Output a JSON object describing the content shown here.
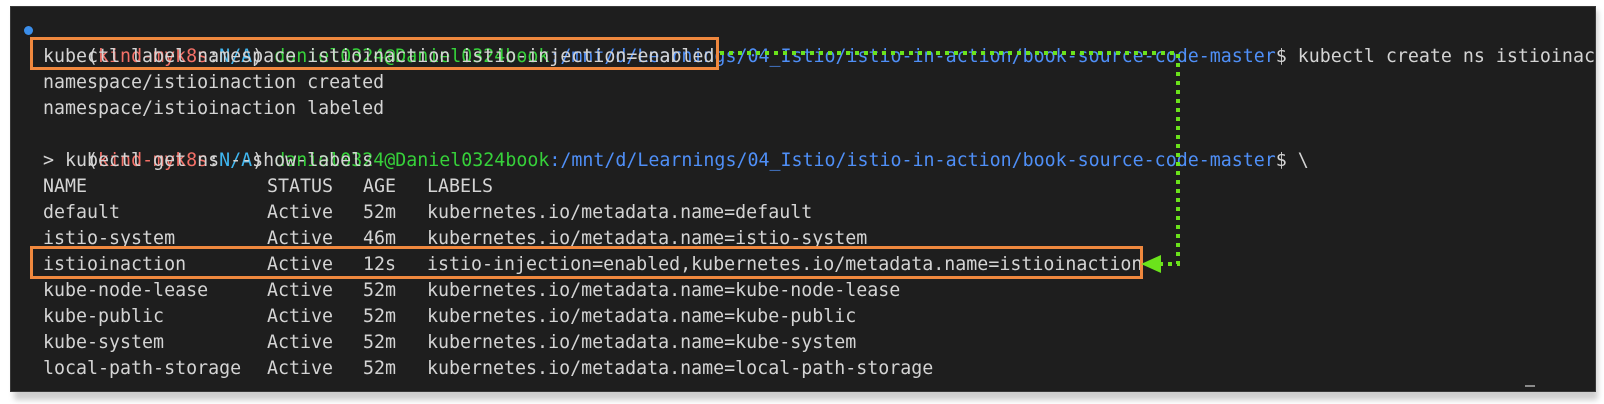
{
  "prompt1": {
    "open_paren": "(",
    "context": "kind-myk8s",
    "colon": ":",
    "namespace": "N/A",
    "close_paren": ")",
    "user": "daniel0324@Daniel0324book",
    "path": ":/mnt/d/Learnings/04_Istio/istio-in-action/book-source-code-master",
    "dollar": "$",
    "command": " kubectl create ns istioinaction"
  },
  "cmd_label": "kubectl label namespace istioinaction istio-injection=enabled",
  "output": {
    "created": "namespace/istioinaction created",
    "labeled": "namespace/istioinaction labeled"
  },
  "prompt2": {
    "open_paren": "(",
    "context": "kind-myk8s",
    "colon": ":",
    "namespace": "N/A",
    "close_paren": ")",
    "user": "daniel0324@Daniel0324book",
    "path": ":/mnt/d/Learnings/04_Istio/istio-in-action/book-source-code-master",
    "dollar": "$",
    "command": " \\"
  },
  "cmd_get": "> kubectl get ns --show-labels",
  "table": {
    "headers": [
      "NAME",
      "STATUS",
      "AGE",
      "LABELS"
    ],
    "rows": [
      [
        "default",
        "Active",
        "52m",
        "kubernetes.io/metadata.name=default"
      ],
      [
        "istio-system",
        "Active",
        "46m",
        "kubernetes.io/metadata.name=istio-system"
      ],
      [
        "istioinaction",
        "Active",
        "12s",
        "istio-injection=enabled,kubernetes.io/metadata.name=istioinaction"
      ],
      [
        "kube-node-lease",
        "Active",
        "52m",
        "kubernetes.io/metadata.name=kube-node-lease"
      ],
      [
        "kube-public",
        "Active",
        "52m",
        "kubernetes.io/metadata.name=kube-public"
      ],
      [
        "kube-system",
        "Active",
        "52m",
        "kubernetes.io/metadata.name=kube-system"
      ],
      [
        "local-path-storage",
        "Active",
        "52m",
        "kubernetes.io/metadata.name=local-path-storage"
      ]
    ]
  },
  "colors": {
    "terminal_bg": "#1e1e1e",
    "highlight_box": "#f0883e",
    "arrow": "#6be31b",
    "context": "#f47067",
    "user": "#36d13a",
    "path": "#4f8ff7"
  }
}
